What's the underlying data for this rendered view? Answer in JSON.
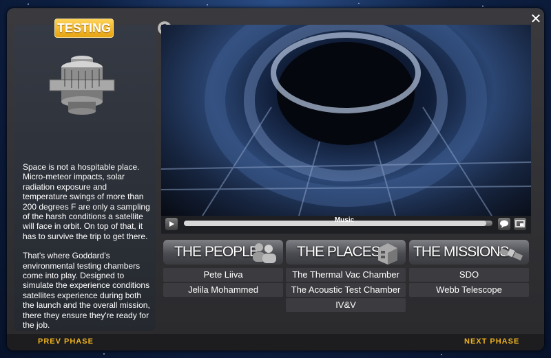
{
  "header": {
    "badge": "TESTING"
  },
  "description": [
    "Space is not a hospitable place. Micro-meteor impacts, solar radiation exposure and temperature swings of more than 200 degrees F are only a sampling of the harsh conditions a satellite will face in orbit. On top of that, it has to survive the trip to get there.",
    "That's where Goddard's environmental testing chambers come into play. Designed to simulate the experience conditions satellites experience during both the launch and the overall mission, there they ensure they're ready for the job."
  ],
  "player": {
    "track_label": "Music",
    "progress": 0.98
  },
  "categories": [
    {
      "title": "THE PEOPLE",
      "icon": "people-icon",
      "items": [
        "Pete Liiva",
        "Jelila Mohammed"
      ]
    },
    {
      "title": "THE PLACES",
      "icon": "building-icon",
      "items": [
        "The Thermal Vac Chamber",
        "The Acoustic Test Chamber",
        "IV&V"
      ]
    },
    {
      "title": "THE MISSIONS",
      "icon": "satellite-icon",
      "items": [
        "SDO",
        "Webb Telescope"
      ]
    }
  ],
  "footer": {
    "prev_label": "PREV PHASE",
    "next_label": "NEXT PHASE"
  },
  "colors": {
    "accent": "#f0b41c",
    "badge": "#f5b41e",
    "panel": "#2d2d30"
  }
}
